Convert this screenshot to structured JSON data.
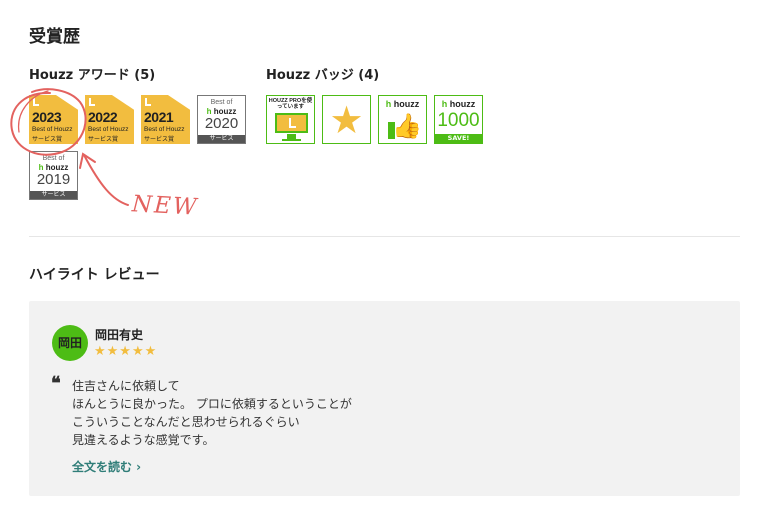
{
  "section": {
    "title": "受賞歴"
  },
  "awards": {
    "title": "Houzz アワード (5)",
    "items": [
      {
        "year": "2023",
        "line1": "Best of Houzz",
        "line2": "サービス賞",
        "style": "gold"
      },
      {
        "year": "2022",
        "line1": "Best of Houzz",
        "line2": "サービス賞",
        "style": "gold"
      },
      {
        "year": "2021",
        "line1": "Best of Houzz",
        "line2": "サービス賞",
        "style": "gold"
      },
      {
        "year": "2020",
        "best_of": "Best of",
        "brand": "houzz",
        "bar": "サービス",
        "style": "white"
      },
      {
        "year": "2019",
        "best_of": "Best of",
        "brand": "houzz",
        "bar": "サービス",
        "style": "white"
      }
    ]
  },
  "badges": {
    "title": "Houzz バッジ (4)",
    "items": [
      {
        "icon": "houzz-pro-monitor-icon",
        "text": "HOUZZ PROを使っています"
      },
      {
        "icon": "star-icon"
      },
      {
        "icon": "thumbs-up-icon",
        "brand": "houzz"
      },
      {
        "icon": "houzz-1000-icon",
        "brand": "houzz",
        "number": "1000",
        "save": "SAVE!"
      }
    ]
  },
  "annotation": {
    "text": "NEW",
    "color": "#e3625f"
  },
  "highlight": {
    "title": "ハイライト レビュー",
    "review": {
      "avatar": "岡田",
      "name": "岡田有史",
      "stars": "★★★★★",
      "quote_mark": "❝",
      "lines": [
        "住吉さんに依頼して",
        "ほんとうに良かった。 プロに依頼するということが",
        "こういうことなんだと思わせられるぐらい",
        "見違えるような感覚です。"
      ],
      "read_more": "全文を読む ›"
    }
  },
  "colors": {
    "gold": "#f2bd3f",
    "green": "#4dbc15",
    "link": "#2f7d78",
    "card_bg": "#f2f2f2"
  }
}
